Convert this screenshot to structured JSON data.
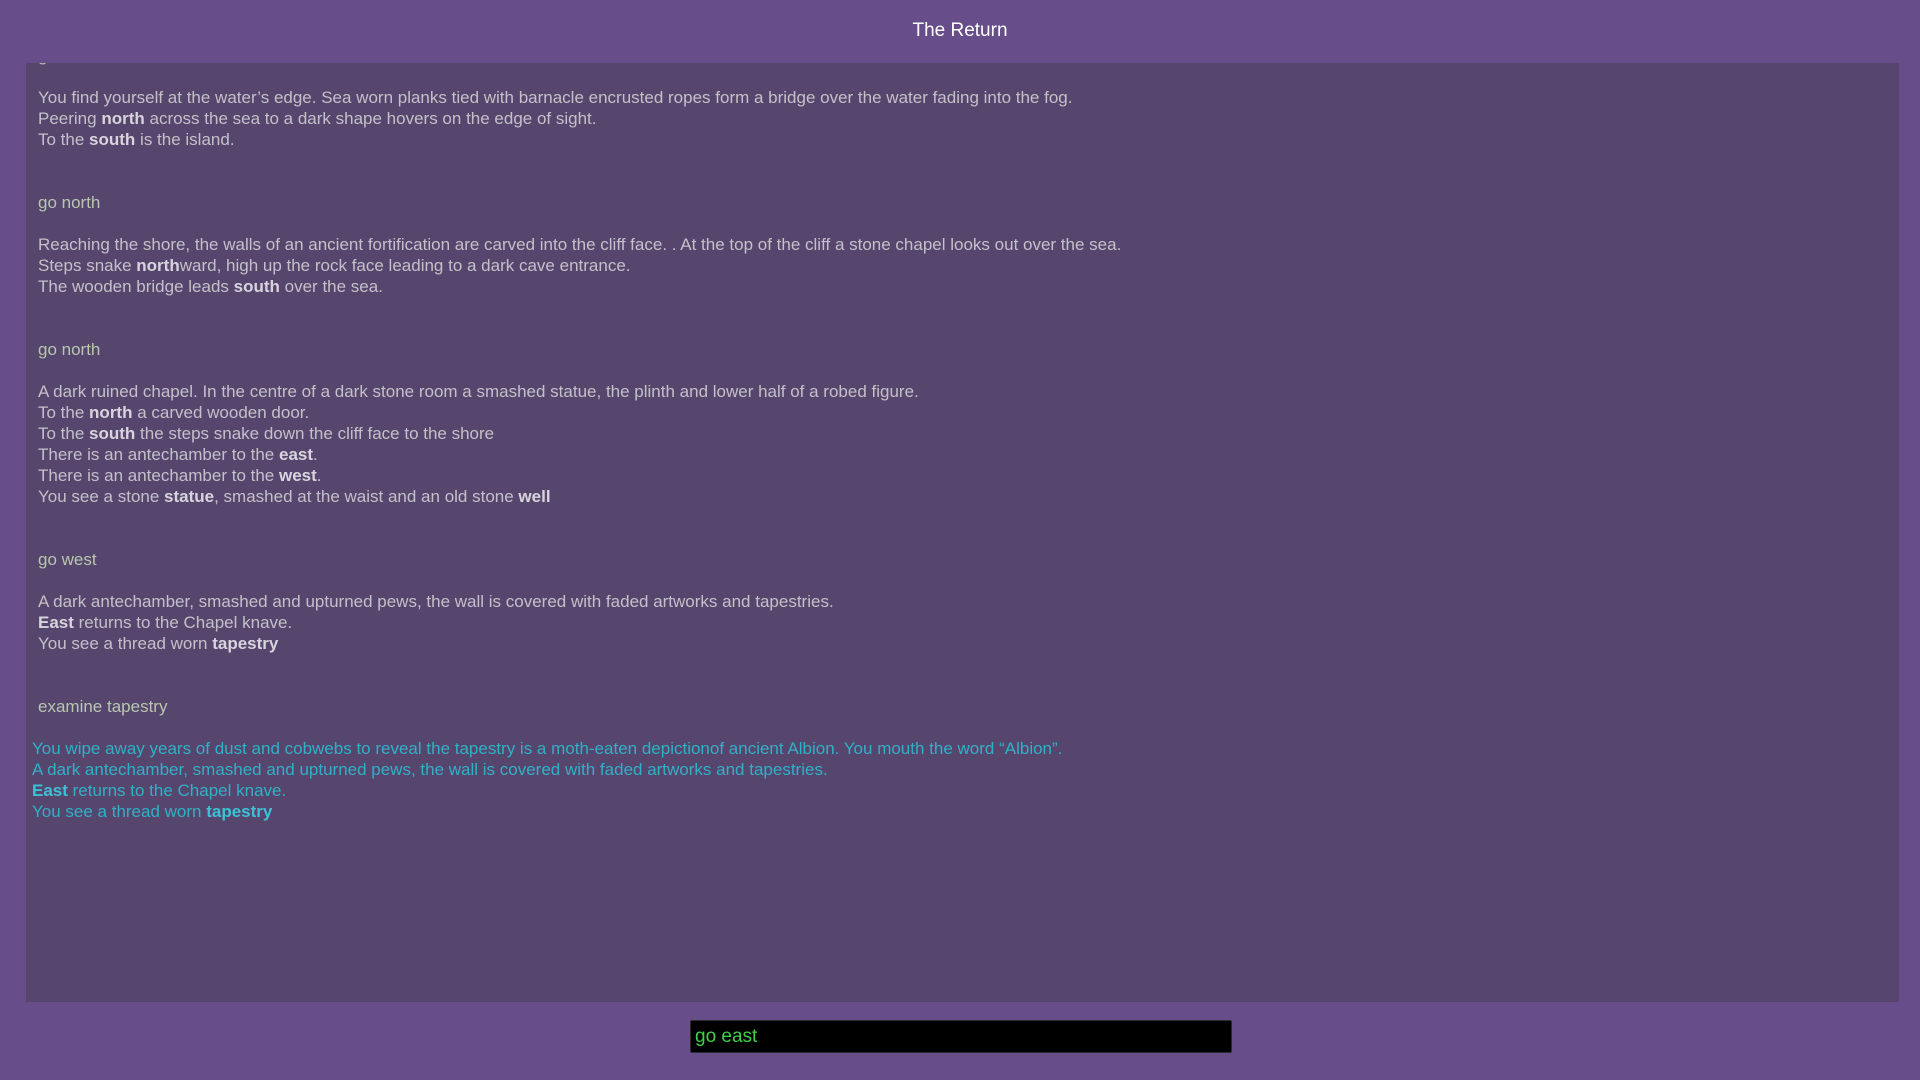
{
  "title": "The Return",
  "log": [
    {
      "command": "go north",
      "lines": [
        [
          {
            "t": "You find yourself at the water’s edge. Sea worn planks tied with barnacle encrusted ropes form a bridge over the water fading into the fog."
          }
        ],
        [
          {
            "t": "Peering "
          },
          {
            "t": "north",
            "b": true
          },
          {
            "t": " across the sea to a dark shape hovers on the edge of sight."
          }
        ],
        [
          {
            "t": "To the "
          },
          {
            "t": "south",
            "b": true
          },
          {
            "t": " is the island."
          }
        ]
      ]
    },
    {
      "command": "go north",
      "lines": [
        [
          {
            "t": "Reaching the shore, the walls of an ancient fortification are carved into the cliff face. . At the top of the cliff a stone chapel looks out over the sea."
          }
        ],
        [
          {
            "t": "Steps snake "
          },
          {
            "t": "north",
            "b": true
          },
          {
            "t": "ward, high up the rock face leading to a dark cave entrance."
          }
        ],
        [
          {
            "t": "The wooden bridge leads "
          },
          {
            "t": "south",
            "b": true
          },
          {
            "t": " over the sea."
          }
        ]
      ]
    },
    {
      "command": "go north",
      "lines": [
        [
          {
            "t": "A dark ruined chapel. In the centre of a dark stone room a smashed statue, the plinth and lower half of a robed figure."
          }
        ],
        [
          {
            "t": "To the "
          },
          {
            "t": "north",
            "b": true
          },
          {
            "t": " a carved wooden door."
          }
        ],
        [
          {
            "t": "To the "
          },
          {
            "t": "south",
            "b": true
          },
          {
            "t": " the steps snake down the cliff face to the shore"
          }
        ],
        [
          {
            "t": "There is an antechamber to the "
          },
          {
            "t": "east",
            "b": true
          },
          {
            "t": "."
          }
        ],
        [
          {
            "t": "There is an antechamber to the "
          },
          {
            "t": "west",
            "b": true
          },
          {
            "t": "."
          }
        ],
        [
          {
            "t": "You see a stone "
          },
          {
            "t": "statue",
            "b": true
          },
          {
            "t": ", smashed at the waist and an old stone "
          },
          {
            "t": "well",
            "b": true
          }
        ]
      ]
    },
    {
      "command": "go west",
      "lines": [
        [
          {
            "t": "A dark antechamber, smashed and upturned pews, the wall is covered with faded artworks and tapestries."
          }
        ],
        [
          {
            "t": "East",
            "b": true
          },
          {
            "t": " returns to the Chapel knave."
          }
        ],
        [
          {
            "t": "You see a thread worn "
          },
          {
            "t": "tapestry",
            "b": true
          }
        ]
      ]
    },
    {
      "command": "examine tapestry",
      "current": true,
      "lines": [
        [
          {
            "t": "You wipe away years of dust and cobwebs to reveal the tapestry is a moth-eaten depictionof ancient Albion. You mouth the word “Albion”."
          }
        ],
        [
          {
            "t": "A dark antechamber, smashed and upturned pews, the wall is covered with faded artworks and tapestries."
          }
        ],
        [
          {
            "t": "East",
            "b": true
          },
          {
            "t": " returns to the Chapel knave."
          }
        ],
        [
          {
            "t": "You see a thread worn "
          },
          {
            "t": "tapestry",
            "b": true
          }
        ]
      ]
    }
  ],
  "input": {
    "value": "go east",
    "placeholder": ""
  },
  "colors": {
    "background": "#674d8a",
    "panel": "#56466d",
    "command_text": "#b8c6b0",
    "description_text": "#c4c0c9",
    "current_text": "#30b0c6",
    "input_text": "#3fd04a"
  }
}
